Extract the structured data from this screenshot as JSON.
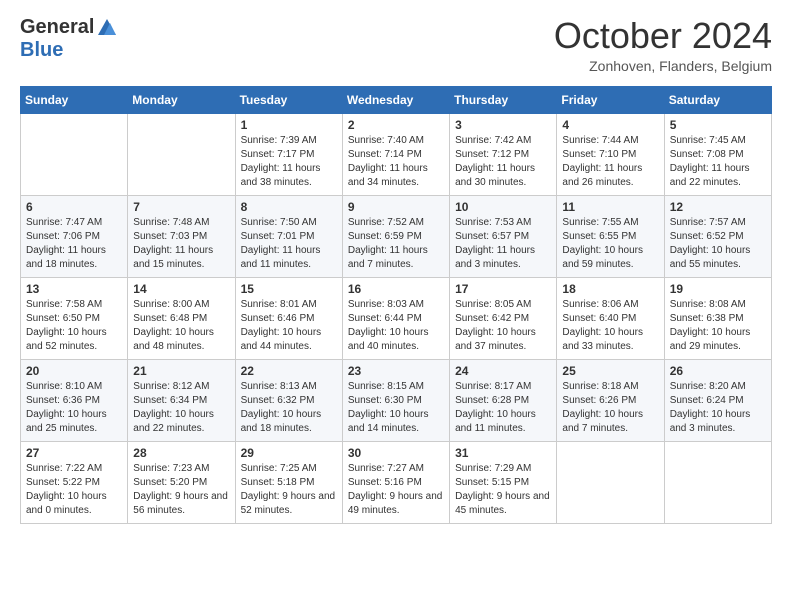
{
  "header": {
    "logo_general": "General",
    "logo_blue": "Blue",
    "month_title": "October 2024",
    "location": "Zonhoven, Flanders, Belgium"
  },
  "days_of_week": [
    "Sunday",
    "Monday",
    "Tuesday",
    "Wednesday",
    "Thursday",
    "Friday",
    "Saturday"
  ],
  "weeks": [
    [
      {
        "day": "",
        "info": ""
      },
      {
        "day": "",
        "info": ""
      },
      {
        "day": "1",
        "info": "Sunrise: 7:39 AM\nSunset: 7:17 PM\nDaylight: 11 hours and 38 minutes."
      },
      {
        "day": "2",
        "info": "Sunrise: 7:40 AM\nSunset: 7:14 PM\nDaylight: 11 hours and 34 minutes."
      },
      {
        "day": "3",
        "info": "Sunrise: 7:42 AM\nSunset: 7:12 PM\nDaylight: 11 hours and 30 minutes."
      },
      {
        "day": "4",
        "info": "Sunrise: 7:44 AM\nSunset: 7:10 PM\nDaylight: 11 hours and 26 minutes."
      },
      {
        "day": "5",
        "info": "Sunrise: 7:45 AM\nSunset: 7:08 PM\nDaylight: 11 hours and 22 minutes."
      }
    ],
    [
      {
        "day": "6",
        "info": "Sunrise: 7:47 AM\nSunset: 7:06 PM\nDaylight: 11 hours and 18 minutes."
      },
      {
        "day": "7",
        "info": "Sunrise: 7:48 AM\nSunset: 7:03 PM\nDaylight: 11 hours and 15 minutes."
      },
      {
        "day": "8",
        "info": "Sunrise: 7:50 AM\nSunset: 7:01 PM\nDaylight: 11 hours and 11 minutes."
      },
      {
        "day": "9",
        "info": "Sunrise: 7:52 AM\nSunset: 6:59 PM\nDaylight: 11 hours and 7 minutes."
      },
      {
        "day": "10",
        "info": "Sunrise: 7:53 AM\nSunset: 6:57 PM\nDaylight: 11 hours and 3 minutes."
      },
      {
        "day": "11",
        "info": "Sunrise: 7:55 AM\nSunset: 6:55 PM\nDaylight: 10 hours and 59 minutes."
      },
      {
        "day": "12",
        "info": "Sunrise: 7:57 AM\nSunset: 6:52 PM\nDaylight: 10 hours and 55 minutes."
      }
    ],
    [
      {
        "day": "13",
        "info": "Sunrise: 7:58 AM\nSunset: 6:50 PM\nDaylight: 10 hours and 52 minutes."
      },
      {
        "day": "14",
        "info": "Sunrise: 8:00 AM\nSunset: 6:48 PM\nDaylight: 10 hours and 48 minutes."
      },
      {
        "day": "15",
        "info": "Sunrise: 8:01 AM\nSunset: 6:46 PM\nDaylight: 10 hours and 44 minutes."
      },
      {
        "day": "16",
        "info": "Sunrise: 8:03 AM\nSunset: 6:44 PM\nDaylight: 10 hours and 40 minutes."
      },
      {
        "day": "17",
        "info": "Sunrise: 8:05 AM\nSunset: 6:42 PM\nDaylight: 10 hours and 37 minutes."
      },
      {
        "day": "18",
        "info": "Sunrise: 8:06 AM\nSunset: 6:40 PM\nDaylight: 10 hours and 33 minutes."
      },
      {
        "day": "19",
        "info": "Sunrise: 8:08 AM\nSunset: 6:38 PM\nDaylight: 10 hours and 29 minutes."
      }
    ],
    [
      {
        "day": "20",
        "info": "Sunrise: 8:10 AM\nSunset: 6:36 PM\nDaylight: 10 hours and 25 minutes."
      },
      {
        "day": "21",
        "info": "Sunrise: 8:12 AM\nSunset: 6:34 PM\nDaylight: 10 hours and 22 minutes."
      },
      {
        "day": "22",
        "info": "Sunrise: 8:13 AM\nSunset: 6:32 PM\nDaylight: 10 hours and 18 minutes."
      },
      {
        "day": "23",
        "info": "Sunrise: 8:15 AM\nSunset: 6:30 PM\nDaylight: 10 hours and 14 minutes."
      },
      {
        "day": "24",
        "info": "Sunrise: 8:17 AM\nSunset: 6:28 PM\nDaylight: 10 hours and 11 minutes."
      },
      {
        "day": "25",
        "info": "Sunrise: 8:18 AM\nSunset: 6:26 PM\nDaylight: 10 hours and 7 minutes."
      },
      {
        "day": "26",
        "info": "Sunrise: 8:20 AM\nSunset: 6:24 PM\nDaylight: 10 hours and 3 minutes."
      }
    ],
    [
      {
        "day": "27",
        "info": "Sunrise: 7:22 AM\nSunset: 5:22 PM\nDaylight: 10 hours and 0 minutes."
      },
      {
        "day": "28",
        "info": "Sunrise: 7:23 AM\nSunset: 5:20 PM\nDaylight: 9 hours and 56 minutes."
      },
      {
        "day": "29",
        "info": "Sunrise: 7:25 AM\nSunset: 5:18 PM\nDaylight: 9 hours and 52 minutes."
      },
      {
        "day": "30",
        "info": "Sunrise: 7:27 AM\nSunset: 5:16 PM\nDaylight: 9 hours and 49 minutes."
      },
      {
        "day": "31",
        "info": "Sunrise: 7:29 AM\nSunset: 5:15 PM\nDaylight: 9 hours and 45 minutes."
      },
      {
        "day": "",
        "info": ""
      },
      {
        "day": "",
        "info": ""
      }
    ]
  ]
}
